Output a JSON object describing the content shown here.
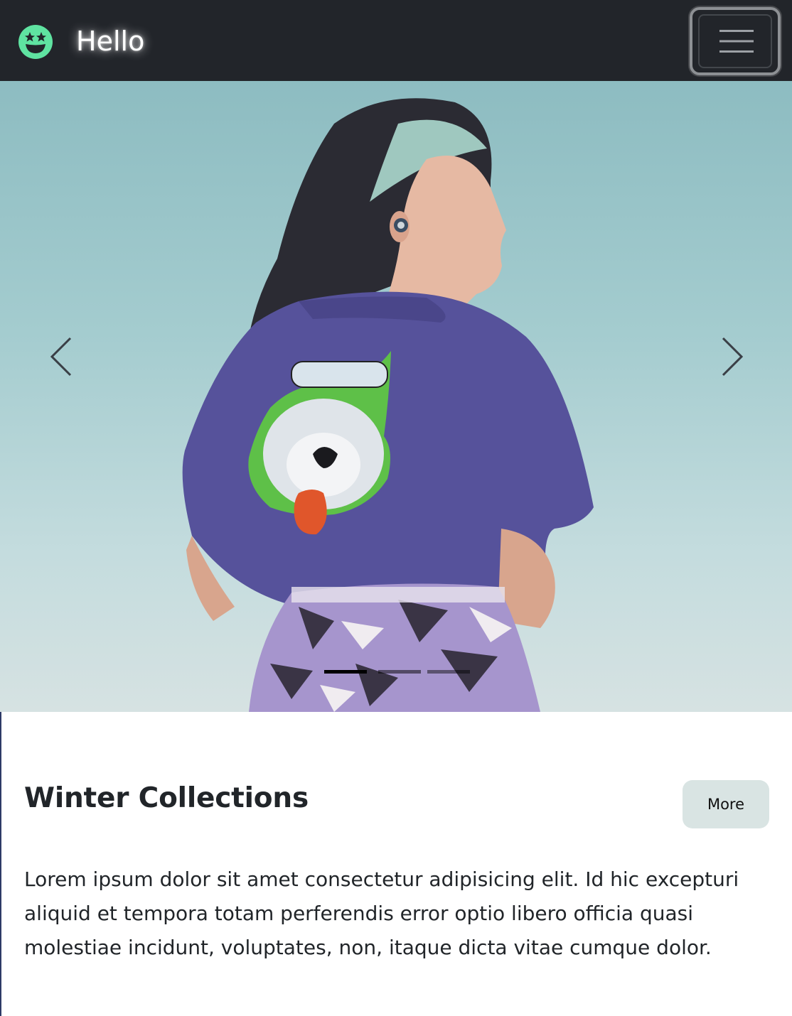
{
  "navbar": {
    "brand_text": "Hello",
    "brand_icon": "star-struck-smiley-icon",
    "toggler_icon": "hamburger-menu-icon",
    "background": "#22252a",
    "brand_icon_color": "#5fe3a1"
  },
  "carousel": {
    "prev_icon": "chevron-left-icon",
    "next_icon": "chevron-right-icon",
    "indicators": [
      {
        "active": true
      },
      {
        "active": false
      },
      {
        "active": false
      }
    ]
  },
  "main": {
    "title": "Winter Collections",
    "more_label": "More",
    "more_button_color": "#d9e4e3",
    "body": "Lorem ipsum dolor sit amet consectetur adipisicing elit. Id hic excepturi aliquid et tempora totam perferendis error optio libero officia quasi molestiae incidunt, voluptates, non, itaque dicta vitae cumque dolor."
  }
}
